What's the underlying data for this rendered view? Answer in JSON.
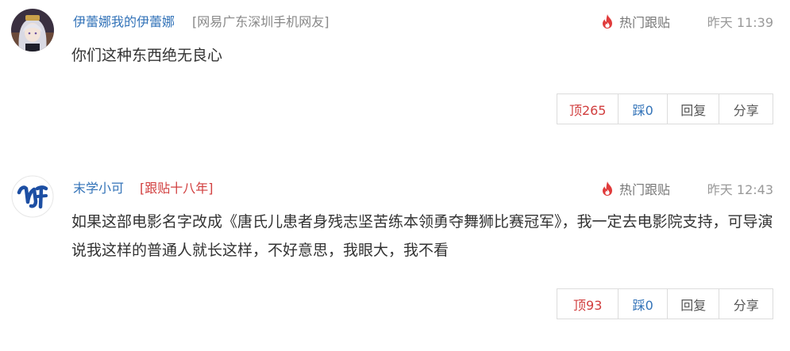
{
  "comments": [
    {
      "username": "伊蕾娜我的伊蕾娜",
      "source": "[网易广东深圳手机网友]",
      "badge": "",
      "hot_label": "热门跟贴",
      "time": "昨天 11:39",
      "content": "你们这种东西绝无良心",
      "actions": {
        "up": "顶265",
        "down": "踩0",
        "reply": "回复",
        "share": "分享"
      },
      "avatar_icon": "anime-girl-avatar"
    },
    {
      "username": "末学小可",
      "source": "",
      "badge": "[跟贴十八年]",
      "hot_label": "热门跟贴",
      "time": "昨天 12:43",
      "content": "如果这部电影名字改成《唐氏儿患者身残志坚苦练本领勇夺舞狮比赛冠军》，我一定去电影院支持，可导演说我这样的普通人就长这样，不好意思，我眼大，我不看",
      "actions": {
        "up": "顶93",
        "down": "踩0",
        "reply": "回复",
        "share": "分享"
      },
      "avatar_icon": "letter-logo-avatar"
    }
  ],
  "colors": {
    "username": "#3373b8",
    "badge": "#d13e3e",
    "flame": "#e03b3b",
    "up_button": "#d13e3e",
    "down_button": "#3373b8"
  },
  "icons": {
    "hot": "flame-icon"
  }
}
